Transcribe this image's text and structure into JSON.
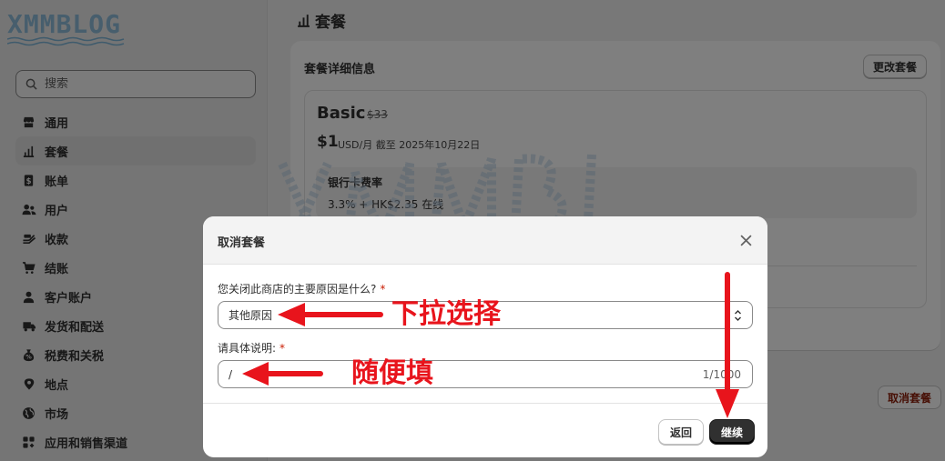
{
  "logo": {
    "text": "XMMBLOG"
  },
  "sidebar": {
    "search_placeholder": "搜索",
    "items": [
      {
        "label": "通用",
        "icon": "store-icon"
      },
      {
        "label": "套餐",
        "icon": "plan-chart-icon"
      },
      {
        "label": "账单",
        "icon": "bill-icon"
      },
      {
        "label": "用户",
        "icon": "users-icon"
      },
      {
        "label": "收款",
        "icon": "payment-icon"
      },
      {
        "label": "结账",
        "icon": "cart-icon"
      },
      {
        "label": "客户账户",
        "icon": "person-icon"
      },
      {
        "label": "发货和配送",
        "icon": "truck-icon"
      },
      {
        "label": "税费和关税",
        "icon": "tax-icon"
      },
      {
        "label": "地点",
        "icon": "location-icon"
      },
      {
        "label": "市场",
        "icon": "globe-icon"
      },
      {
        "label": "应用和销售渠道",
        "icon": "apps-icon"
      }
    ]
  },
  "main": {
    "page_title": "套餐",
    "card_title": "套餐详细信息",
    "change_plan_label": "更改套餐",
    "plan_name": "Basic",
    "plan_old_price": "$33",
    "plan_price": "$1",
    "plan_meta": "USD/月 截至 2025年10月22日",
    "rate_title": "银行卡费率",
    "rate_value": "3.3% + HK$2.35 在线",
    "cancel_plan_label": "取消套餐"
  },
  "modal": {
    "title": "取消套餐",
    "question_label": "您关闭此商店的主要原因是什么?",
    "required_mark": "*",
    "selected_reason": "其他原因",
    "detail_label": "请具体说明:",
    "detail_value": "/",
    "counter": "1/1000",
    "back_label": "返回",
    "continue_label": "继续"
  },
  "annotations": {
    "dropdown_note": "下拉选择",
    "fill_note": "随便填",
    "color": "#e8141c"
  }
}
